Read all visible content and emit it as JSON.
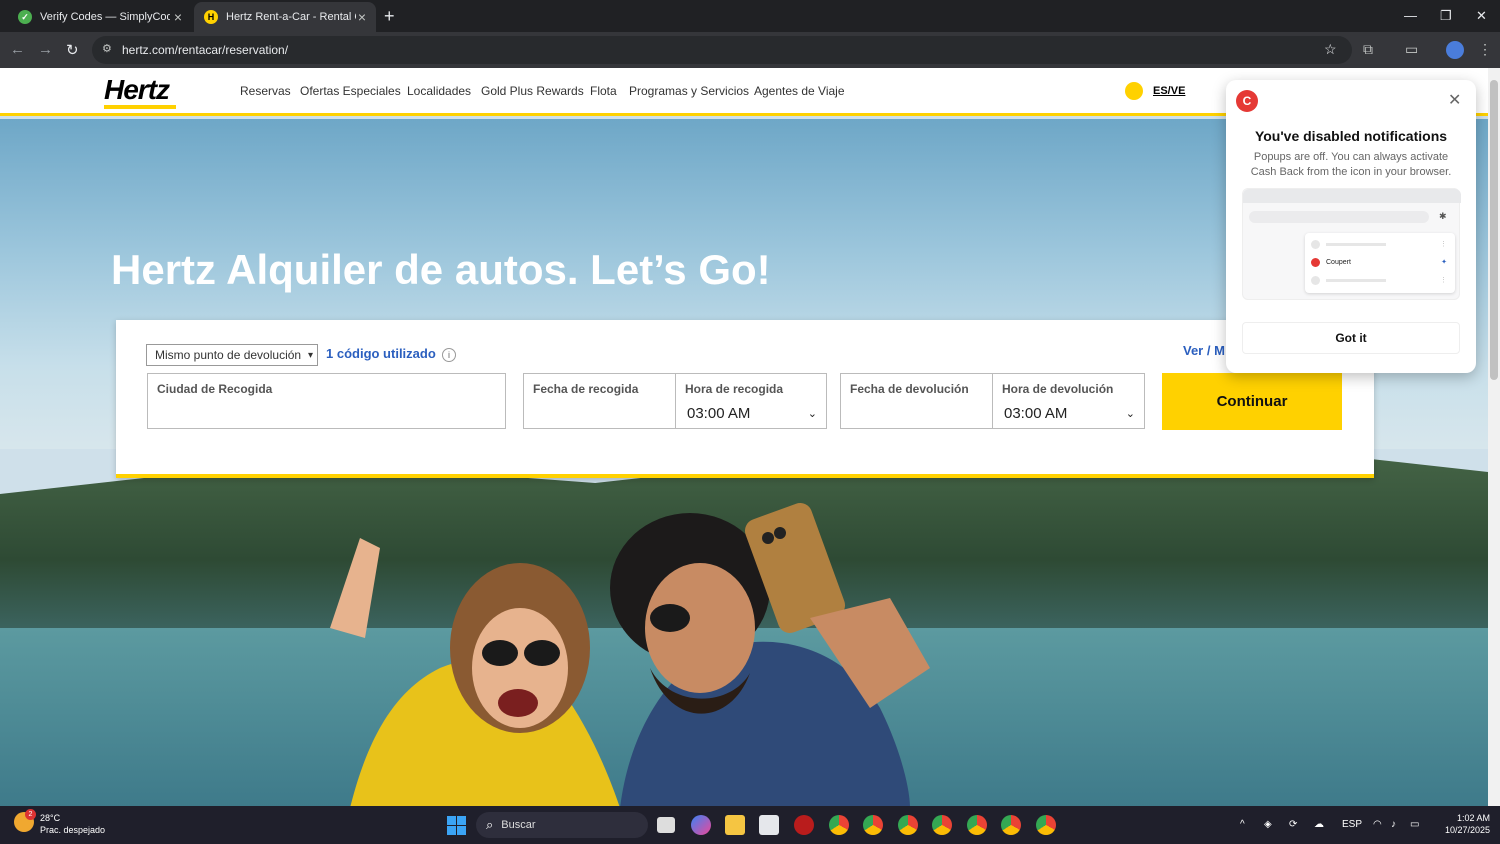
{
  "browser": {
    "tabs": [
      {
        "title": "Verify Codes — SimplyCodes",
        "active": false
      },
      {
        "title": "Hertz Rent-a-Car - Rental Car D",
        "active": true
      }
    ],
    "url": "hertz.com/rentacar/reservation/"
  },
  "site": {
    "logo": "Hertz",
    "nav": [
      "Reservas",
      "Ofertas Especiales",
      "Localidades",
      "Gold Plus Rewards",
      "Flota",
      "Programas y Servicios",
      "Agentes de Viaje"
    ],
    "locale": "ES/VE"
  },
  "hero": {
    "title": "Hertz Alquiler de autos. Let’s Go!"
  },
  "booking": {
    "return_option": "Mismo punto de devolución",
    "codes_used": "1 código utilizado",
    "info_icon": "i",
    "ver_link": "Ver / M",
    "pickup_city_label": "Ciudad de Recogida",
    "pickup_date_label": "Fecha de recogida",
    "pickup_time_label": "Hora de recogida",
    "pickup_time_value": "03:00 AM",
    "return_date_label": "Fecha de devolución",
    "return_time_label": "Hora de devolución",
    "return_time_value": "03:00 AM",
    "continue_label": "Continuar"
  },
  "popup": {
    "logo_letter": "C",
    "title": "You've disabled notifications",
    "body": "Popups are off. You can always activate Cash Back from the icon in your browser.",
    "illustration_item": "Coupert",
    "button": "Got it"
  },
  "taskbar": {
    "temperature": "28°C",
    "weather": "Prac. despejado",
    "weather_badge": "2",
    "search": "Buscar",
    "language": "ESP",
    "time": "1:02 AM",
    "date": "10/27/2025"
  },
  "colors": {
    "hertz_yellow": "#ffd100",
    "link_blue": "#2b5fbf",
    "chrome_dark": "#202124"
  }
}
